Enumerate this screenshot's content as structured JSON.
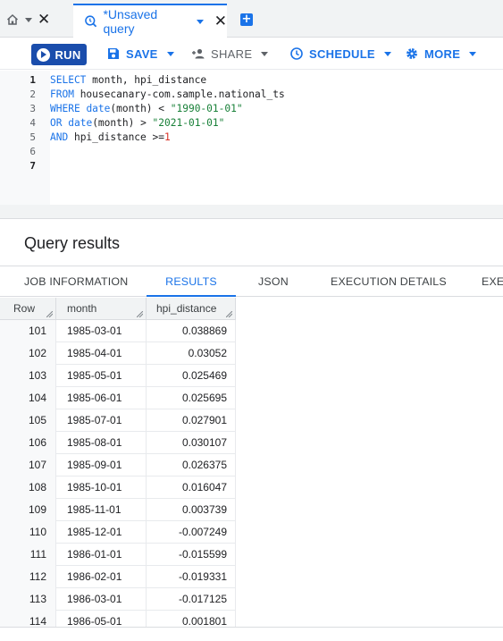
{
  "tabs": {
    "active_title": "*Unsaved query"
  },
  "toolbar": {
    "run": "RUN",
    "save": "SAVE",
    "share": "SHARE",
    "schedule": "SCHEDULE",
    "more": "MORE"
  },
  "editor": {
    "lines": [
      {
        "n": "1",
        "t": [
          [
            "kw",
            "SELECT"
          ],
          [
            "plain",
            " month, hpi_distance"
          ]
        ]
      },
      {
        "n": "2",
        "t": [
          [
            "kw",
            "FROM"
          ],
          [
            "plain",
            " housecanary-com.sample.national_ts"
          ]
        ]
      },
      {
        "n": "3",
        "t": [
          [
            "kw",
            "WHERE"
          ],
          [
            "plain",
            " "
          ],
          [
            "kw",
            "date"
          ],
          [
            "plain",
            "(month) < "
          ],
          [
            "str",
            "\"1990-01-01\""
          ]
        ]
      },
      {
        "n": "4",
        "t": [
          [
            "kw",
            "OR"
          ],
          [
            "plain",
            " "
          ],
          [
            "kw",
            "date"
          ],
          [
            "plain",
            "(month) > "
          ],
          [
            "str",
            "\"2021-01-01\""
          ]
        ]
      },
      {
        "n": "5",
        "t": [
          [
            "kw",
            "AND"
          ],
          [
            "plain",
            " hpi_distance >="
          ],
          [
            "num",
            "1"
          ]
        ]
      },
      {
        "n": "6",
        "t": []
      },
      {
        "n": "7",
        "t": []
      }
    ]
  },
  "results": {
    "title": "Query results",
    "tabs": [
      "JOB INFORMATION",
      "RESULTS",
      "JSON",
      "EXECUTION DETAILS",
      "EXEC"
    ],
    "columns": [
      "Row",
      "month",
      "hpi_distance"
    ],
    "rows": [
      [
        "101",
        "1985-03-01",
        "0.038869"
      ],
      [
        "102",
        "1985-04-01",
        "0.03052"
      ],
      [
        "103",
        "1985-05-01",
        "0.025469"
      ],
      [
        "104",
        "1985-06-01",
        "0.025695"
      ],
      [
        "105",
        "1985-07-01",
        "0.027901"
      ],
      [
        "106",
        "1985-08-01",
        "0.030107"
      ],
      [
        "107",
        "1985-09-01",
        "0.026375"
      ],
      [
        "108",
        "1985-10-01",
        "0.016047"
      ],
      [
        "109",
        "1985-11-01",
        "0.003739"
      ],
      [
        "110",
        "1985-12-01",
        "-0.007249"
      ],
      [
        "111",
        "1986-01-01",
        "-0.015599"
      ],
      [
        "112",
        "1986-02-01",
        "-0.019331"
      ],
      [
        "113",
        "1986-03-01",
        "-0.017125"
      ],
      [
        "114",
        "1986-05-01",
        "0.001801"
      ]
    ]
  },
  "colors": {
    "accent": "#1a73e8",
    "run_button": "#1a4dac",
    "string": "#188038",
    "number": "#d93025"
  }
}
